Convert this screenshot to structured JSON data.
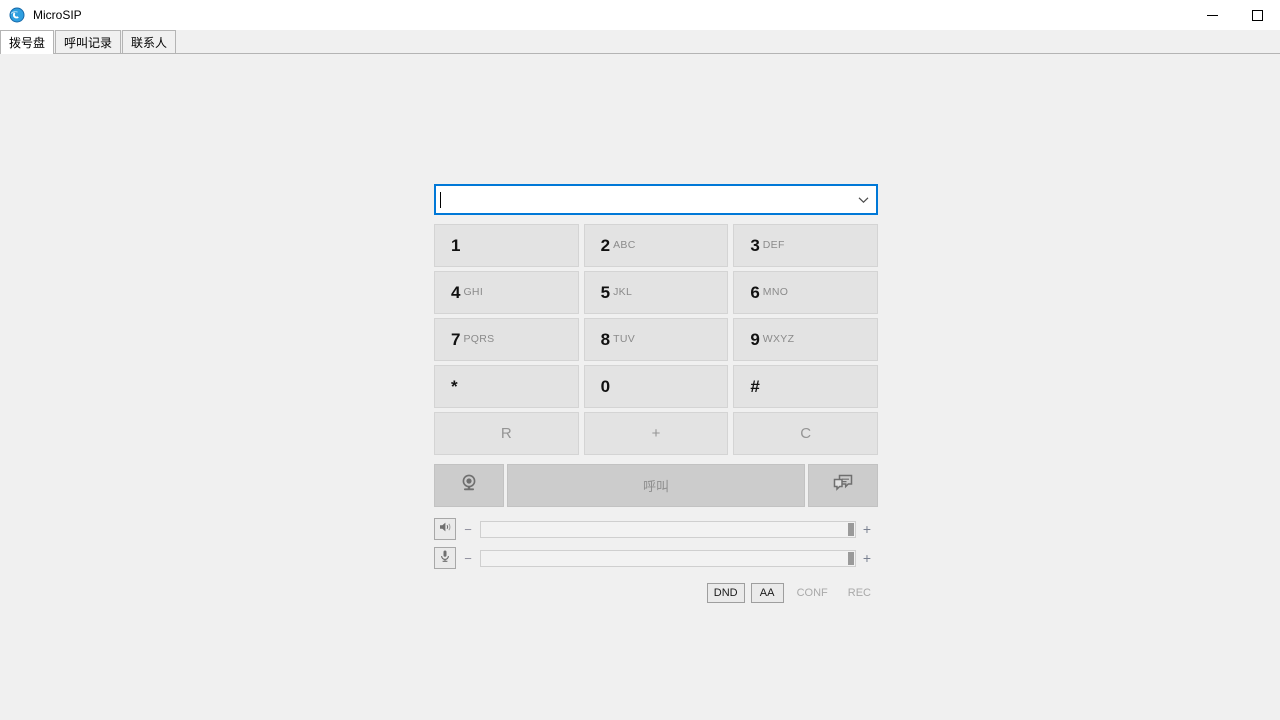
{
  "window": {
    "title": "MicroSIP",
    "app_icon": "microsip-globe-icon",
    "controls": {
      "minimize": "minimize-button",
      "maximize": "maximize-button"
    }
  },
  "tabs": [
    {
      "label": "拨号盘",
      "name": "tab-dialpad",
      "active": true
    },
    {
      "label": "呼叫记录",
      "name": "tab-call-log",
      "active": false
    },
    {
      "label": "联系人",
      "name": "tab-contacts",
      "active": false
    }
  ],
  "dialer": {
    "number_input": {
      "value": "",
      "placeholder": "",
      "focused": true,
      "dropdown_icon": "chevron-down-icon"
    },
    "keys": [
      {
        "digit": "1",
        "letters": ""
      },
      {
        "digit": "2",
        "letters": "ABC"
      },
      {
        "digit": "3",
        "letters": "DEF"
      },
      {
        "digit": "4",
        "letters": "GHI"
      },
      {
        "digit": "5",
        "letters": "JKL"
      },
      {
        "digit": "6",
        "letters": "MNO"
      },
      {
        "digit": "7",
        "letters": "PQRS"
      },
      {
        "digit": "8",
        "letters": "TUV"
      },
      {
        "digit": "9",
        "letters": "WXYZ"
      },
      {
        "digit": "*",
        "letters": ""
      },
      {
        "digit": "0",
        "letters": ""
      },
      {
        "digit": "#",
        "letters": ""
      }
    ],
    "function_keys": [
      {
        "label": "R",
        "name": "key-r"
      },
      {
        "label": "+",
        "name": "key-plus"
      },
      {
        "label": "C",
        "name": "key-clear"
      }
    ],
    "actions": {
      "video_icon": "webcam-icon",
      "call_label": "呼叫",
      "message_icon": "chat-bubbles-icon"
    },
    "volume": {
      "speaker": {
        "icon": "speaker-icon",
        "decrease": "−",
        "increase": "+",
        "level": 100
      },
      "microphone": {
        "icon": "microphone-icon",
        "decrease": "−",
        "increase": "+",
        "level": 100
      }
    },
    "toggles": [
      {
        "label": "DND",
        "name": "toggle-dnd",
        "enabled": true
      },
      {
        "label": "AA",
        "name": "toggle-aa",
        "enabled": true
      },
      {
        "label": "CONF",
        "name": "toggle-conf",
        "enabled": false
      },
      {
        "label": "REC",
        "name": "toggle-rec",
        "enabled": false
      }
    ]
  },
  "colors": {
    "window_background": "#f0f0f0",
    "titlebar": "#ffffff",
    "focus_border": "#0078d7",
    "key_face": "#e3e3e3",
    "action_face": "#cccccc",
    "disabled_text": "#a9a9a9"
  }
}
